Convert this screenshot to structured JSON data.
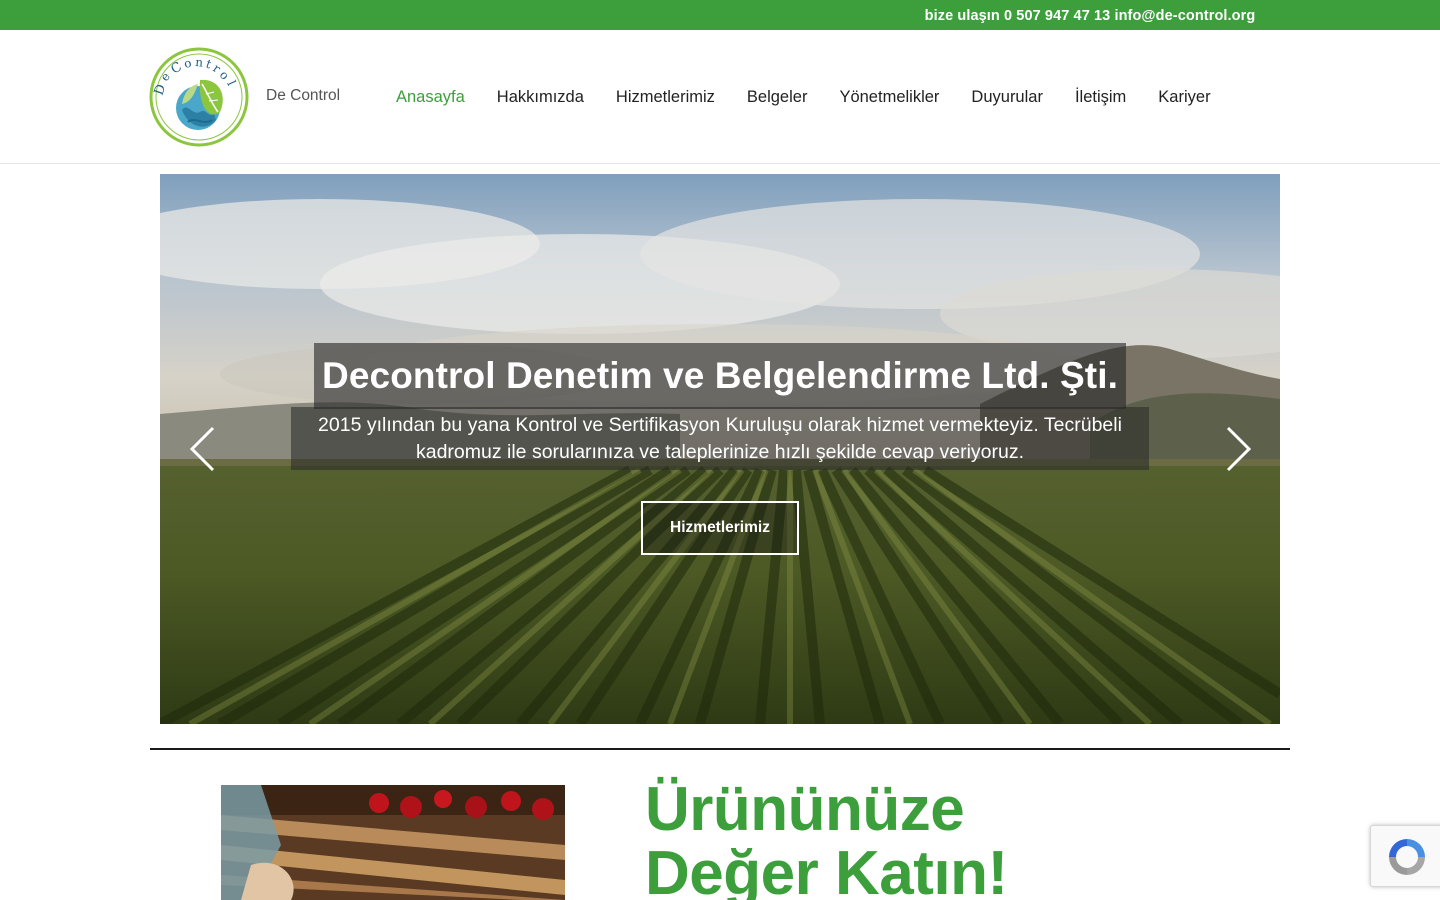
{
  "topbar": {
    "contact_text": "bize ulaşın 0 507 947 47 13 info@de-control.org"
  },
  "header": {
    "logo_alt": "De Control",
    "brand_name": "De Control",
    "nav": [
      {
        "label": "Anasayfa",
        "active": true
      },
      {
        "label": "Hakkımızda"
      },
      {
        "label": "Hizmetlerimiz"
      },
      {
        "label": "Belgeler"
      },
      {
        "label": "Yönetmelikler"
      },
      {
        "label": "Duyurular"
      },
      {
        "label": "İletişim"
      },
      {
        "label": "Kariyer"
      }
    ]
  },
  "hero": {
    "title": "Decontrol Denetim ve Belgelendirme Ltd. Şti.",
    "subtitle": "2015 yılından bu yana Kontrol ve Sertifikasyon Kuruluşu olarak hizmet vermekteyiz. Tecrübeli kadromuz ile sorularınıza ve taleplerinize hızlı şekilde cevap veriyoruz.",
    "button_label": "Hizmetlerimiz"
  },
  "section": {
    "headline_line1": "Ürününüze",
    "headline_line2": "Değer Katın!"
  },
  "colors": {
    "brand_green": "#3c9f3c"
  },
  "icons": {
    "prev": "chevron-left-icon",
    "next": "chevron-right-icon",
    "captcha": "recaptcha-icon"
  }
}
